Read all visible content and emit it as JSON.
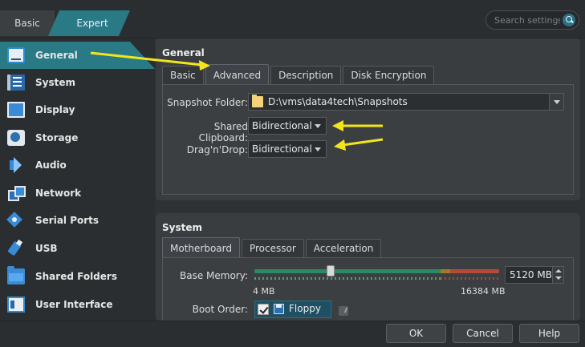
{
  "modes": {
    "basic": "Basic",
    "expert": "Expert"
  },
  "search": {
    "placeholder": "Search settings"
  },
  "sidebar": {
    "items": [
      {
        "label": "General",
        "icon": "general-icon"
      },
      {
        "label": "System",
        "icon": "system-icon"
      },
      {
        "label": "Display",
        "icon": "display-icon"
      },
      {
        "label": "Storage",
        "icon": "storage-icon"
      },
      {
        "label": "Audio",
        "icon": "audio-icon"
      },
      {
        "label": "Network",
        "icon": "network-icon"
      },
      {
        "label": "Serial Ports",
        "icon": "serial-ports-icon"
      },
      {
        "label": "USB",
        "icon": "usb-icon"
      },
      {
        "label": "Shared Folders",
        "icon": "shared-folders-icon"
      },
      {
        "label": "User Interface",
        "icon": "user-interface-icon"
      }
    ],
    "active": "General"
  },
  "general": {
    "title": "General",
    "tabs": [
      "Basic",
      "Advanced",
      "Description",
      "Disk Encryption"
    ],
    "active_tab": "Advanced",
    "snapshot_folder_label": "Snapshot Folder:",
    "snapshot_folder_value": "D:\\vms\\data4tech\\Snapshots",
    "clipboard_label": "Shared Clipboard:",
    "clipboard_value": "Bidirectional",
    "dragdrop_label": "Drag'n'Drop:",
    "dragdrop_value": "Bidirectional"
  },
  "system": {
    "title": "System",
    "tabs": [
      "Motherboard",
      "Processor",
      "Acceleration"
    ],
    "active_tab": "Motherboard",
    "base_memory_label": "Base Memory:",
    "base_memory_value": "5120 MB",
    "base_memory_fraction": 0.3125,
    "min_label": "4 MB",
    "max_label": "16384 MB",
    "boot_order_label": "Boot Order:",
    "boot_items": [
      {
        "label": "Floppy",
        "checked": true
      }
    ]
  },
  "buttons": {
    "ok": "OK",
    "cancel": "Cancel",
    "help": "Help"
  },
  "colors": {
    "accent": "#2a7a86",
    "annotation_arrow": "#f2e51b"
  }
}
